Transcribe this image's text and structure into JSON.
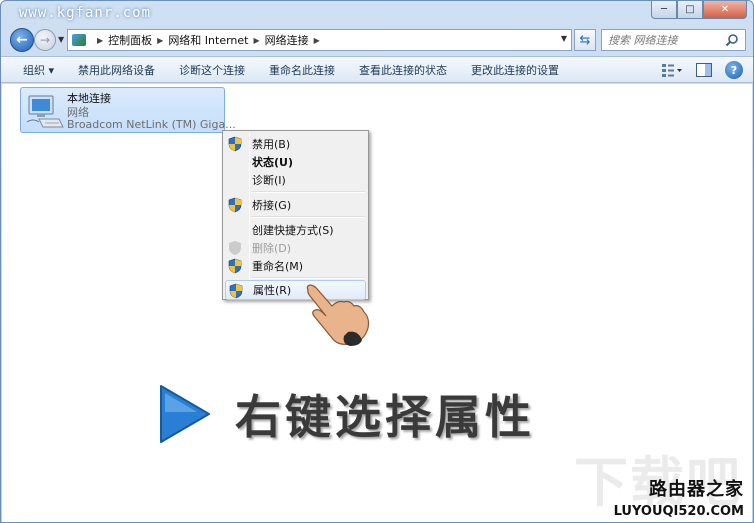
{
  "window": {
    "watermark_url": "www.kgfanr.com"
  },
  "caption_buttons": {
    "minimize": "─",
    "maximize": "□",
    "close": "✕"
  },
  "address_bar": {
    "breadcrumbs": [
      "控制面板",
      "网络和 Internet",
      "网络连接"
    ]
  },
  "search": {
    "placeholder": "搜索 网络连接"
  },
  "command_bar": {
    "organize": "组织 ▾",
    "disable_device": "禁用此网络设备",
    "diagnose": "诊断这个连接",
    "rename": "重命名此连接",
    "view_status": "查看此连接的状态",
    "change_settings": "更改此连接的设置"
  },
  "connection": {
    "name": "本地连接",
    "status": "网络",
    "adapter": "Broadcom NetLink (TM) Giga..."
  },
  "context_menu": {
    "items": [
      {
        "label": "禁用(B)",
        "shield": true,
        "bold": false,
        "disabled": false
      },
      {
        "label": "状态(U)",
        "shield": false,
        "bold": true,
        "disabled": false
      },
      {
        "label": "诊断(I)",
        "shield": false,
        "bold": false,
        "disabled": false
      },
      {
        "label": "桥接(G)",
        "shield": true,
        "bold": false,
        "disabled": false
      },
      {
        "label": "创建快捷方式(S)",
        "shield": false,
        "bold": false,
        "disabled": false
      },
      {
        "label": "删除(D)",
        "shield": true,
        "bold": false,
        "disabled": true
      },
      {
        "label": "重命名(M)",
        "shield": true,
        "bold": false,
        "disabled": false
      },
      {
        "label": "属性(R)",
        "shield": true,
        "bold": false,
        "disabled": false,
        "highlighted": true
      }
    ]
  },
  "banner": {
    "text": "右键选择属性"
  },
  "site_logo": {
    "mark": "下载吧",
    "name_cn": "路由器之家",
    "name_en": "LUYOUQI520.COM"
  },
  "colors": {
    "accent": "#1d5fb0",
    "selection": "#c4defa",
    "shield_blue": "#2f6fc4",
    "shield_yellow": "#f2c23a",
    "play_blue": "#2a7fd4"
  }
}
